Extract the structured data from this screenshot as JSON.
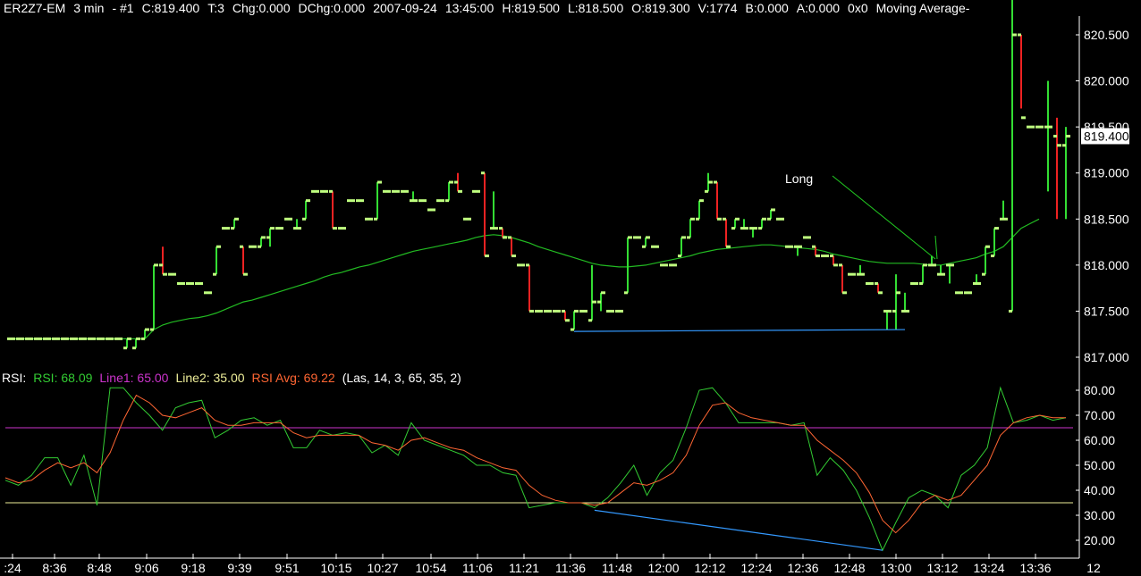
{
  "header": {
    "symbol": "ER2Z7-EM",
    "interval": "3 min",
    "instance": "- #1",
    "close": "C:819.400",
    "tick": "T:3",
    "chg": "Chg:0.000",
    "dchg": "DChg:0.000",
    "date": "2007-09-24",
    "time": "13:45:00",
    "high": "H:819.500",
    "low": "L:818.500",
    "open": "O:819.300",
    "volume": "V:1774",
    "bid": "B:0.000",
    "ask": "A:0.000",
    "extra": "0x0",
    "study": "Moving Average-"
  },
  "rsi_header": {
    "name": "RSI:",
    "rsi": "RSI: 68.09",
    "line1": "Line1: 65.00",
    "line2": "Line2: 35.00",
    "avg": "RSI Avg: 69.22",
    "params": "(Las, 14, 3, 65, 35, 2)"
  },
  "colors": {
    "background": "#000000",
    "up_bar": "#bfff7f",
    "up_wick": "#33dd33",
    "down_wick": "#ee2222",
    "ma": "#22bb22",
    "rsi": "#33cc33",
    "rsi_avg": "#ff6633",
    "line1": "#cc33cc",
    "line2": "#eeee99",
    "trendline": "#3399ff",
    "arrow": "#22cc22"
  },
  "chart_data": [
    {
      "type": "ohlc",
      "ylim": [
        816.8,
        820.7
      ],
      "yticks": [
        "820.500",
        "820.000",
        "819.500",
        "819.000",
        "818.500",
        "818.000",
        "817.500",
        "817.000"
      ],
      "last_price_label": "819.400",
      "annotation": "Long",
      "bars": [
        [
          817.2,
          817.2,
          817.2,
          817.2
        ],
        [
          817.2,
          817.2,
          817.2,
          817.2
        ],
        [
          817.2,
          817.2,
          817.2,
          817.2
        ],
        [
          817.2,
          817.2,
          817.2,
          817.2
        ],
        [
          817.2,
          817.2,
          817.2,
          817.2
        ],
        [
          817.2,
          817.2,
          817.2,
          817.2
        ],
        [
          817.2,
          817.2,
          817.2,
          817.2
        ],
        [
          817.2,
          817.2,
          817.2,
          817.2
        ],
        [
          817.2,
          817.2,
          817.2,
          817.2
        ],
        [
          817.2,
          817.2,
          817.2,
          817.2
        ],
        [
          817.2,
          817.2,
          817.2,
          817.2
        ],
        [
          817.2,
          817.2,
          817.2,
          817.2
        ],
        [
          817.2,
          817.2,
          817.2,
          817.2
        ],
        [
          817.1,
          817.2,
          817.1,
          817.2
        ],
        [
          817.1,
          817.2,
          817.1,
          817.2
        ],
        [
          817.2,
          817.3,
          817.2,
          817.3
        ],
        [
          817.3,
          818.0,
          817.3,
          818.0
        ],
        [
          818.0,
          818.2,
          817.9,
          817.9
        ],
        [
          817.9,
          817.9,
          817.9,
          817.9
        ],
        [
          817.8,
          817.8,
          817.8,
          817.8
        ],
        [
          817.8,
          817.8,
          817.8,
          817.8
        ],
        [
          817.8,
          817.8,
          817.8,
          817.8
        ],
        [
          817.7,
          817.7,
          817.7,
          817.7
        ],
        [
          817.9,
          818.2,
          817.9,
          818.2
        ],
        [
          818.4,
          818.4,
          818.4,
          818.4
        ],
        [
          818.4,
          818.5,
          818.4,
          818.5
        ],
        [
          818.2,
          818.2,
          817.9,
          817.9
        ],
        [
          818.2,
          818.2,
          818.2,
          818.2
        ],
        [
          818.2,
          818.3,
          818.2,
          818.3
        ],
        [
          818.3,
          818.4,
          818.2,
          818.4
        ],
        [
          818.4,
          818.4,
          818.4,
          818.4
        ],
        [
          818.5,
          818.5,
          818.5,
          818.5
        ],
        [
          818.4,
          818.5,
          818.4,
          818.4
        ],
        [
          818.5,
          818.7,
          818.5,
          818.7
        ],
        [
          818.8,
          818.8,
          818.8,
          818.8
        ],
        [
          818.8,
          818.8,
          818.8,
          818.8
        ],
        [
          818.8,
          818.8,
          818.4,
          818.4
        ],
        [
          818.4,
          818.4,
          818.4,
          818.4
        ],
        [
          818.7,
          818.7,
          818.7,
          818.7
        ],
        [
          818.7,
          818.7,
          818.7,
          818.7
        ],
        [
          818.5,
          818.5,
          818.5,
          818.5
        ],
        [
          818.5,
          818.9,
          818.5,
          818.9
        ],
        [
          818.8,
          818.8,
          818.8,
          818.8
        ],
        [
          818.8,
          818.8,
          818.8,
          818.8
        ],
        [
          818.8,
          818.8,
          818.8,
          818.8
        ],
        [
          818.7,
          818.8,
          818.7,
          818.7
        ],
        [
          818.7,
          818.7,
          818.7,
          818.7
        ],
        [
          818.6,
          818.6,
          818.6,
          818.6
        ],
        [
          818.7,
          818.7,
          818.7,
          818.7
        ],
        [
          818.7,
          818.9,
          818.7,
          818.9
        ],
        [
          818.9,
          819.0,
          818.8,
          818.8
        ],
        [
          818.5,
          818.5,
          818.5,
          818.5
        ],
        [
          818.8,
          818.8,
          818.8,
          818.8
        ],
        [
          819.0,
          819.0,
          818.1,
          818.1
        ],
        [
          818.4,
          818.8,
          818.4,
          818.4
        ],
        [
          818.4,
          818.4,
          818.3,
          818.3
        ],
        [
          818.3,
          818.3,
          818.1,
          818.1
        ],
        [
          818.0,
          818.0,
          818.0,
          818.0
        ],
        [
          818.0,
          818.0,
          817.5,
          817.5
        ],
        [
          817.5,
          817.5,
          817.5,
          817.5
        ],
        [
          817.5,
          817.5,
          817.5,
          817.5
        ],
        [
          817.5,
          817.5,
          817.5,
          817.5
        ],
        [
          817.5,
          817.5,
          817.4,
          817.4
        ],
        [
          817.3,
          817.5,
          817.3,
          817.5
        ],
        [
          817.5,
          817.5,
          817.5,
          817.5
        ],
        [
          817.4,
          818.0,
          817.4,
          817.6
        ],
        [
          817.6,
          817.7,
          817.5,
          817.7
        ],
        [
          817.5,
          817.5,
          817.5,
          817.5
        ],
        [
          817.5,
          817.5,
          817.5,
          817.5
        ],
        [
          817.7,
          818.3,
          817.7,
          818.3
        ],
        [
          818.3,
          818.3,
          818.3,
          818.3
        ],
        [
          818.2,
          818.3,
          818.2,
          818.3
        ],
        [
          818.2,
          818.2,
          818.2,
          818.2
        ],
        [
          818.0,
          818.0,
          818.0,
          818.0
        ],
        [
          818.0,
          818.0,
          818.0,
          818.0
        ],
        [
          818.1,
          818.3,
          818.1,
          818.3
        ],
        [
          818.3,
          818.5,
          818.3,
          818.5
        ],
        [
          818.5,
          818.7,
          818.5,
          818.7
        ],
        [
          818.8,
          819.0,
          818.8,
          818.9
        ],
        [
          818.9,
          818.9,
          818.5,
          818.5
        ],
        [
          818.5,
          818.5,
          818.2,
          818.2
        ],
        [
          818.4,
          818.5,
          818.4,
          818.5
        ],
        [
          818.4,
          818.5,
          818.4,
          818.4
        ],
        [
          818.4,
          818.4,
          818.3,
          818.4
        ],
        [
          818.4,
          818.5,
          818.4,
          818.5
        ],
        [
          818.5,
          818.6,
          818.5,
          818.6
        ],
        [
          818.5,
          818.5,
          818.5,
          818.5
        ],
        [
          818.2,
          818.2,
          818.2,
          818.2
        ],
        [
          818.2,
          818.2,
          818.1,
          818.2
        ],
        [
          818.3,
          818.3,
          818.3,
          818.3
        ],
        [
          818.2,
          818.2,
          818.1,
          818.1
        ],
        [
          818.1,
          818.1,
          818.1,
          818.1
        ],
        [
          818.1,
          818.1,
          818.0,
          818.0
        ],
        [
          818.0,
          818.0,
          817.7,
          817.7
        ],
        [
          817.9,
          817.9,
          817.9,
          817.9
        ],
        [
          817.9,
          818.0,
          817.9,
          817.9
        ],
        [
          817.8,
          817.8,
          817.8,
          817.8
        ],
        [
          817.8,
          817.8,
          817.7,
          817.7
        ],
        [
          817.5,
          817.5,
          817.3,
          817.5
        ],
        [
          817.5,
          817.9,
          817.3,
          817.7
        ],
        [
          817.5,
          817.7,
          817.5,
          817.5
        ],
        [
          817.8,
          817.8,
          817.8,
          817.8
        ],
        [
          817.8,
          818.0,
          817.8,
          818.0
        ],
        [
          818.0,
          818.1,
          818.0,
          818.0
        ],
        [
          817.9,
          818.0,
          817.9,
          817.9
        ],
        [
          818.0,
          818.0,
          817.8,
          818.0
        ],
        [
          817.7,
          817.7,
          817.7,
          817.7
        ],
        [
          817.7,
          817.7,
          817.7,
          817.7
        ],
        [
          817.8,
          817.9,
          817.8,
          817.8
        ],
        [
          817.9,
          818.2,
          817.9,
          818.2
        ],
        [
          818.1,
          818.4,
          818.1,
          818.4
        ],
        [
          818.5,
          818.7,
          818.5,
          818.5
        ],
        [
          817.5,
          820.9,
          817.5,
          820.5
        ],
        [
          820.5,
          820.5,
          819.7,
          819.6
        ],
        [
          819.5,
          819.5,
          819.5,
          819.5
        ],
        [
          819.5,
          819.5,
          819.5,
          819.5
        ],
        [
          819.5,
          820.0,
          818.8,
          819.5
        ],
        [
          819.4,
          819.6,
          818.5,
          819.3
        ],
        [
          819.3,
          819.5,
          818.5,
          819.4
        ]
      ],
      "ma": [
        817.2,
        817.2,
        817.2,
        817.2,
        817.2,
        817.2,
        817.2,
        817.2,
        817.2,
        817.2,
        817.2,
        817.2,
        817.2,
        817.2,
        817.2,
        817.2,
        817.3,
        817.35,
        817.38,
        817.4,
        817.42,
        817.43,
        817.45,
        817.48,
        817.52,
        817.56,
        817.6,
        817.62,
        817.65,
        817.68,
        817.71,
        817.74,
        817.77,
        817.8,
        817.83,
        817.87,
        817.9,
        817.92,
        817.95,
        817.98,
        818.0,
        818.03,
        818.06,
        818.09,
        818.12,
        818.15,
        818.17,
        818.19,
        818.21,
        818.23,
        818.25,
        818.27,
        818.3,
        818.32,
        818.33,
        818.32,
        818.3,
        818.27,
        818.24,
        818.2,
        818.17,
        818.14,
        818.11,
        818.08,
        818.05,
        818.02,
        818.0,
        817.99,
        817.98,
        817.98,
        817.99,
        818.0,
        818.02,
        818.04,
        818.06,
        818.08,
        818.1,
        818.13,
        818.15,
        818.17,
        818.18,
        818.19,
        818.2,
        818.21,
        818.22,
        818.22,
        818.21,
        818.2,
        818.19,
        818.18,
        818.17,
        818.15,
        818.12,
        818.1,
        818.08,
        818.06,
        818.04,
        818.03,
        818.02,
        818.02,
        818.02,
        818.02,
        818.01,
        818.0,
        818.0,
        818.02,
        818.04,
        818.06,
        818.08,
        818.12,
        818.15,
        818.2,
        818.3,
        818.4,
        818.45,
        818.5
      ]
    },
    {
      "type": "line",
      "ylim": [
        13,
        84
      ],
      "yticks": [
        "80.00",
        "70.00",
        "60.00",
        "50.00",
        "40.00",
        "30.00",
        "20.00"
      ],
      "line1": 65,
      "line2": 35,
      "series": [
        {
          "name": "RSI",
          "values": [
            44,
            42,
            46,
            53,
            53,
            42,
            54,
            34,
            81,
            81,
            75,
            70,
            64,
            73,
            75,
            76,
            61,
            64,
            68,
            69,
            66,
            68,
            57,
            57,
            64,
            62,
            63,
            62,
            55,
            58,
            54,
            67,
            60,
            58,
            56,
            54,
            50,
            50,
            47,
            46,
            33,
            34,
            35,
            35,
            35,
            33,
            37,
            43,
            50,
            38,
            47,
            52,
            65,
            80,
            81,
            75,
            67,
            67,
            67,
            67,
            66,
            67,
            46,
            53,
            48,
            40,
            29,
            16,
            27,
            37,
            40,
            38,
            33,
            46,
            50,
            57,
            81,
            67,
            68,
            70,
            68,
            69
          ]
        },
        {
          "name": "RSI Avg",
          "values": [
            45,
            43,
            44,
            48,
            51,
            49,
            51,
            47,
            55,
            68,
            78,
            75,
            70,
            69,
            71,
            73,
            68,
            66,
            66,
            67,
            67,
            67,
            63,
            61,
            62,
            62,
            62,
            62,
            59,
            58,
            56,
            60,
            61,
            59,
            57,
            56,
            53,
            51,
            49,
            48,
            42,
            38,
            36,
            35,
            35,
            34,
            35,
            39,
            43,
            42,
            44,
            47,
            54,
            66,
            74,
            75,
            71,
            69,
            68,
            67,
            66,
            66,
            60,
            56,
            52,
            47,
            39,
            28,
            23,
            28,
            35,
            38,
            36,
            38,
            44,
            50,
            62,
            67,
            69,
            70,
            69,
            69
          ]
        }
      ]
    }
  ],
  "x_axis": {
    "labels": [
      ":24",
      "8:36",
      "8:48",
      "9:06",
      "9:18",
      "9:39",
      "9:51",
      "10:15",
      "10:27",
      "10:54",
      "11:06",
      "11:21",
      "11:36",
      "11:48",
      "12:00",
      "12:12",
      "12:24",
      "12:36",
      "12:48",
      "13:00",
      "13:12",
      "13:24",
      "13:36",
      "12"
    ]
  }
}
